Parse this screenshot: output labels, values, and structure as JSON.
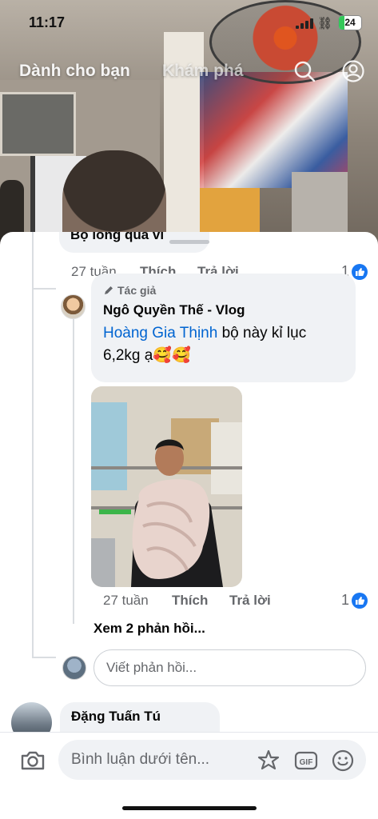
{
  "status_bar": {
    "time": "11:17",
    "battery": "24"
  },
  "top_nav": {
    "tab_for_you": "Dành cho bạn",
    "tab_explore": "Khám phá"
  },
  "previous_comment": {
    "text_fragment": "Bộ lòng quá vĩ",
    "time": "27 tuần",
    "like_label": "Thích",
    "reply_label": "Trả lời",
    "reaction_count": "1"
  },
  "reply": {
    "author_tag": "Tác giả",
    "author_name": "Ngô Quyền Thế - Vlog",
    "mention": "Hoàng Gia Thịnh",
    "text": " bộ này kỉ lục 6,2kg ạ🥰🥰",
    "time": "27 tuần",
    "like_label": "Thích",
    "reply_label": "Trả lời",
    "reaction_count": "1"
  },
  "see_more_replies": "Xem 2 phản hồi...",
  "reply_input_placeholder": "Viết phản hồi...",
  "next_comment": {
    "author_name": "Đặng Tuấn Tú"
  },
  "composer": {
    "placeholder": "Bình luận dưới tên..."
  },
  "icons": {
    "search": "search-icon",
    "profile": "profile-icon",
    "like": "like-thumb-icon",
    "camera": "camera-icon",
    "sticker": "sticker-icon",
    "gif": "gif-icon",
    "emoji": "emoji-icon",
    "pencil": "pencil-icon"
  },
  "colors": {
    "accent": "#1877f2",
    "mention": "#0064d1",
    "secondary_text": "#65676b",
    "bubble": "#f0f2f5"
  }
}
